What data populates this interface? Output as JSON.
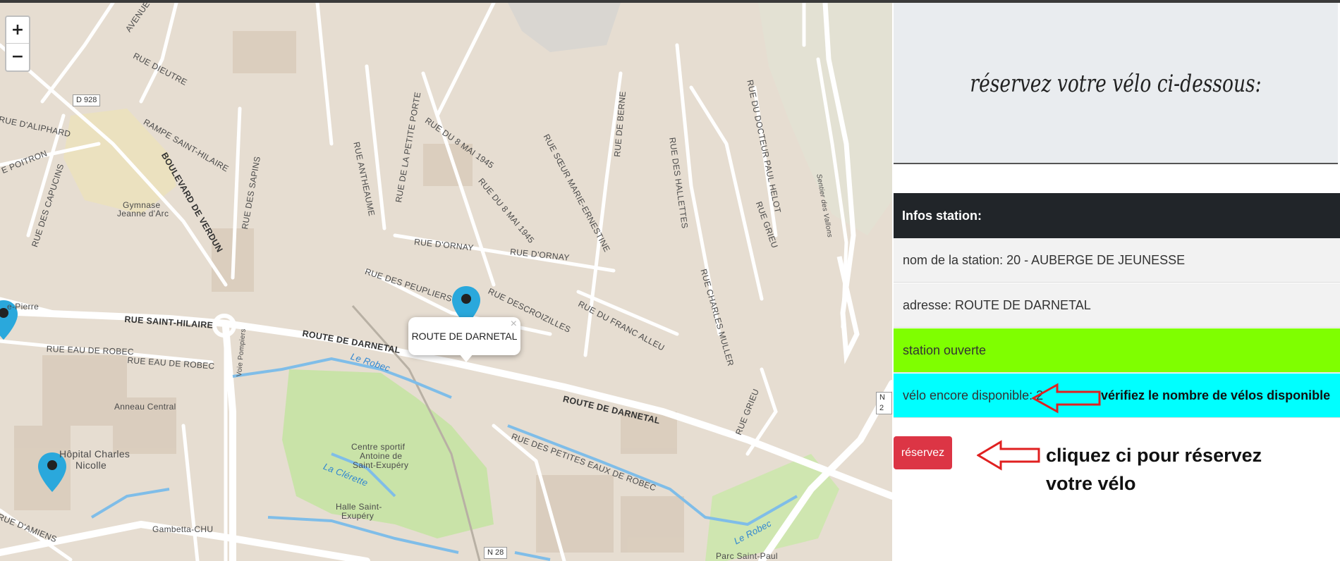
{
  "map": {
    "zoom_in": "+",
    "zoom_out": "−",
    "popup": {
      "title": "ROUTE DE DARNETAL",
      "close": "×"
    },
    "streets": {
      "dieutre": "RUE DIEUTRE",
      "d928": "D 928",
      "aliphard": "RUE D'ALIPHARD",
      "rampe": "RAMPE SAINT-HILAIRE",
      "verdun": "BOULEVARD DE VERDUN",
      "poitron": "E POITRON",
      "capucins": "RUE DES CAPUCINS",
      "sapins": "RUE DES SAPINS",
      "antheaume": "RUE ANTHEAUME",
      "petite_porte": "RUE DE LA PETITE PORTE",
      "mai1": "RUE DU 8 MAI 1945",
      "mai2": "RUE DU 8 MAI 1945",
      "soeur": "RUE SŒUR MARIE-ERNESTINE",
      "berne": "RUE DE BERNE",
      "hallettes": "RUE DES HALLETTES",
      "docteur": "RUE DU DOCTEUR PAUL HELOT",
      "grieu1": "RUE GRIEU",
      "grieu2": "RUE GRIEU",
      "ornay1": "RUE D'ORNAY",
      "ornay2": "RUE D'ORNAY",
      "peupliers": "RUE DES PEUPLIERS",
      "descroizilles": "RUE DESCROIZILLES",
      "franc_alleu": "RUE DU FRANC ALLEU",
      "charles_muller": "RUE CHARLES MULLER",
      "saint_hilaire": "RUE SAINT-HILAIRE",
      "pierre": "e-Pierre",
      "eau_robec1": "RUE EAU DE ROBEC",
      "eau_robec2": "RUE EAU DE ROBEC",
      "darnetal1": "ROUTE DE DARNETAL",
      "darnetal2": "ROUTE DE DARNETAL",
      "petites_eaux": "RUE DES PETITES EAUX DE ROBEC",
      "pompiers": "Voie Pompiers",
      "amiens": "RUE D'AMIENS",
      "n28": "N 28",
      "n2": "N 2",
      "sentier": "Sentier des Vallons",
      "avenue": "AVENUE",
      "robec1": "Le Robec",
      "robec2": "Le Robec",
      "clerette": "La Clérette"
    },
    "places": {
      "gymnase1": "Gymnase",
      "gymnase2": "Jeanne d'Arc",
      "anneau": "Anneau Central",
      "hopital1": "Hôpital Charles",
      "hopital2": "Nicolle",
      "centre1": "Centre sportif",
      "centre2": "Antoine de",
      "centre3": "Saint-Exupéry",
      "halle1": "Halle Saint-",
      "halle2": "Exupéry",
      "gambetta": "Gambetta-CHU",
      "parc": "Parc Saint-Paul"
    },
    "colors": {
      "background": "#e6ddd1",
      "water": "#7fbde8",
      "park": "#c9e3a8",
      "marker": "#2aa8dc"
    }
  },
  "panel": {
    "title": "réservez votre vélo ci-dessous:",
    "info_header": "Infos station:",
    "station_name": "nom de la station: 20 - AUBERGE DE JEUNESSE",
    "address": "adresse: ROUTE DE DARNETAL",
    "status": "station ouverte",
    "bikes": "vélo encore disponible: 2",
    "reserve_button": "réservez",
    "note_bikes": "vérifiez le nombre de vélos disponible",
    "note_reserve": "cliquez ci pour réservez votre vélo",
    "colors": {
      "status_bg": "#7fff00",
      "bikes_bg": "#00ffff",
      "button_bg": "#dc3545",
      "header_bg": "#212529",
      "arrow": "#e02020"
    }
  }
}
